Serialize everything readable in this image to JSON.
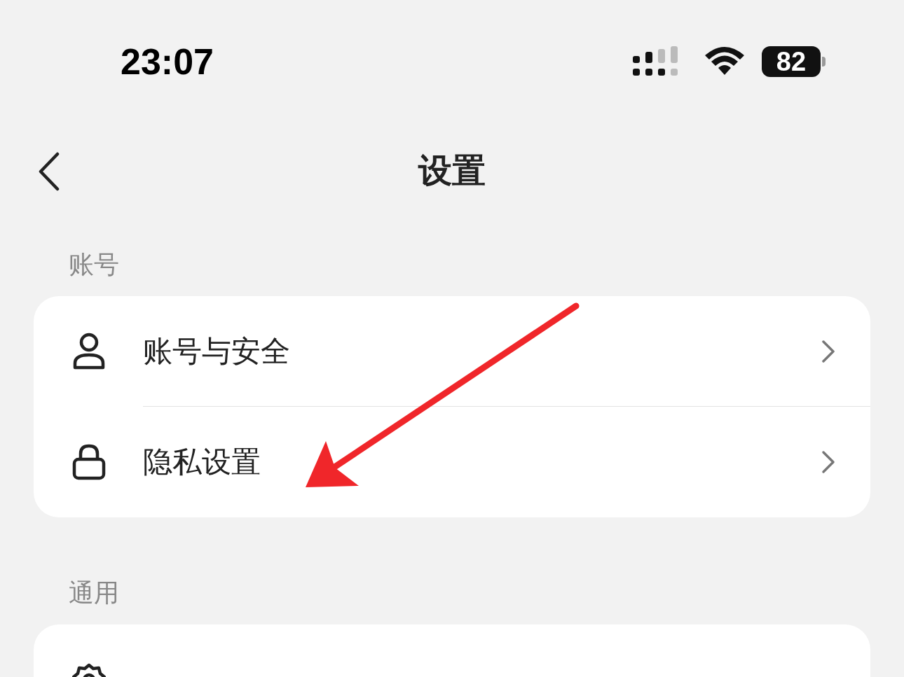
{
  "status_bar": {
    "time": "23:07",
    "battery": "82"
  },
  "nav": {
    "title": "设置"
  },
  "sections": [
    {
      "header": "账号",
      "items": [
        {
          "kind": "person",
          "label": "账号与安全"
        },
        {
          "kind": "lock",
          "label": "隐私设置"
        }
      ]
    },
    {
      "header": "通用",
      "items": [
        {
          "kind": "gear"
        }
      ]
    }
  ]
}
